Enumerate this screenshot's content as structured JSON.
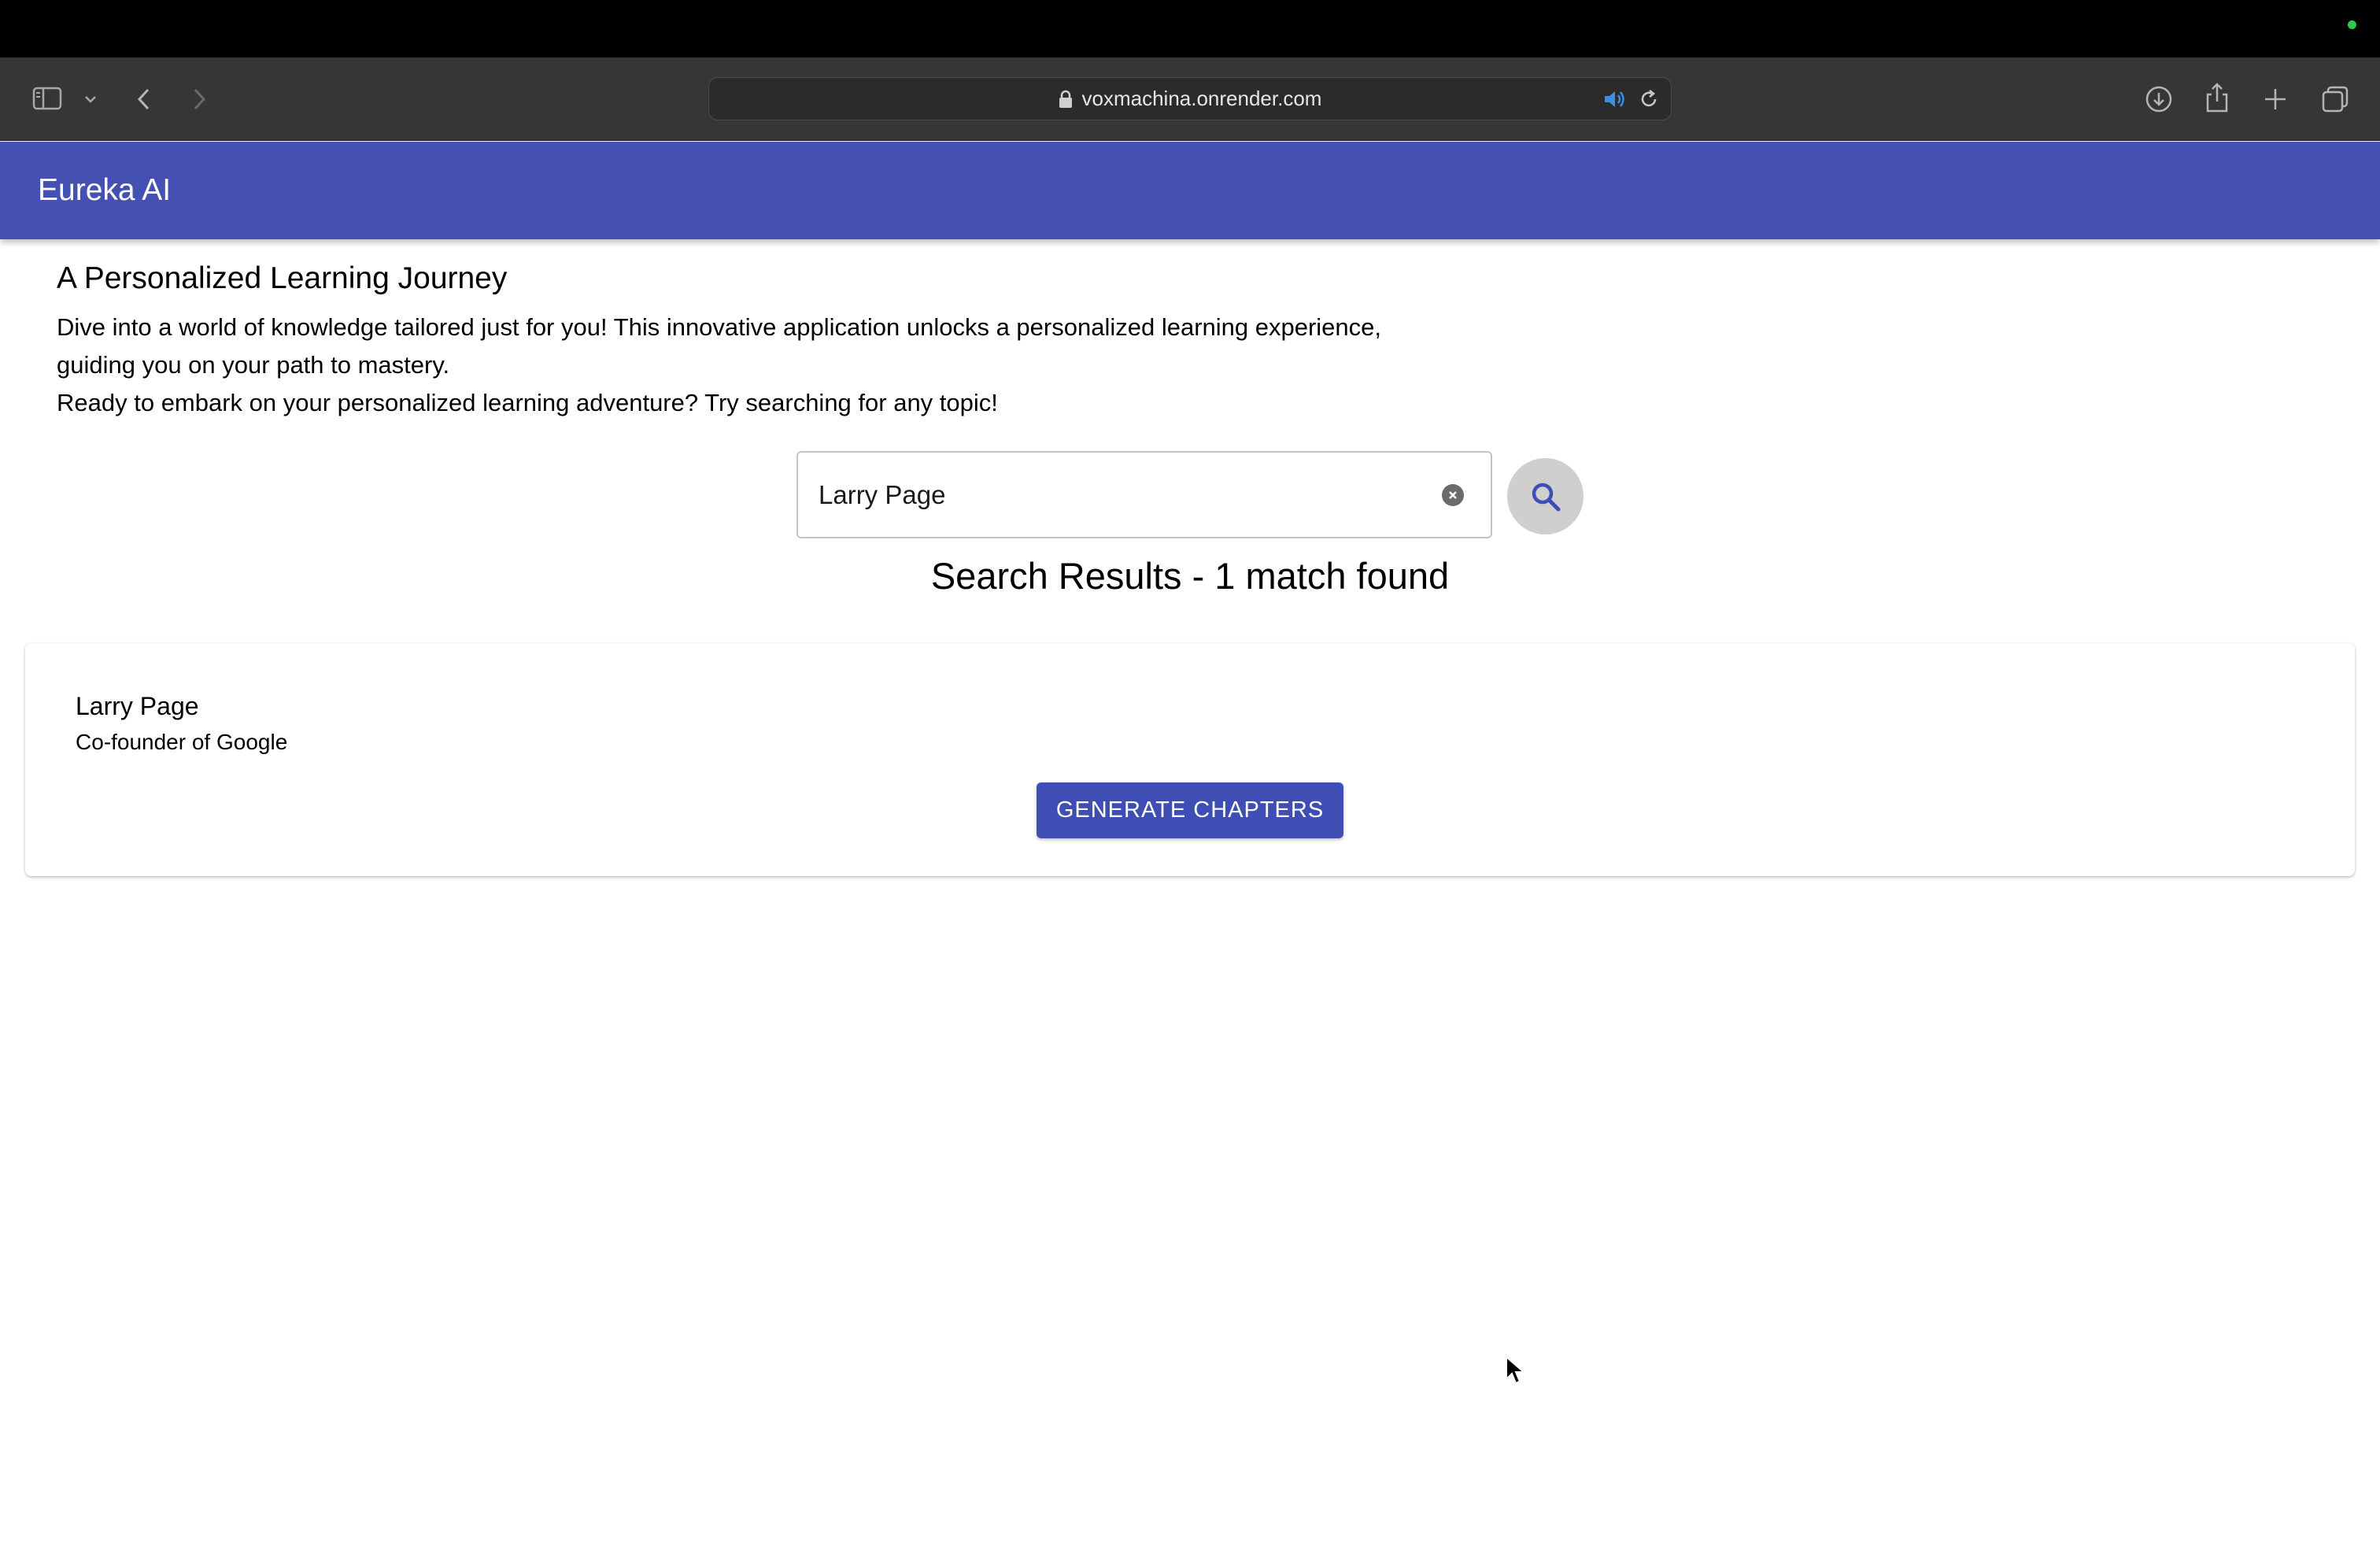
{
  "browser": {
    "url": "voxmachina.onrender.com"
  },
  "app": {
    "title": "Eureka AI"
  },
  "intro": {
    "title": "A Personalized Learning Journey",
    "line1": "Dive into a world of knowledge tailored just for you! This innovative application unlocks a personalized learning experience,",
    "line2": "guiding you on your path to mastery.",
    "line3": "Ready to embark on your personalized learning adventure? Try searching for any topic!"
  },
  "search": {
    "value": "Larry Page"
  },
  "results": {
    "heading": "Search Results - 1 match found",
    "items": [
      {
        "name": "Larry Page",
        "description": "Co-founder of Google",
        "button_label": "GENERATE CHAPTERS"
      }
    ]
  },
  "colors": {
    "header": "#4451b3",
    "primary_button": "#3f4eb5",
    "search_button": "#cfcfcf"
  }
}
